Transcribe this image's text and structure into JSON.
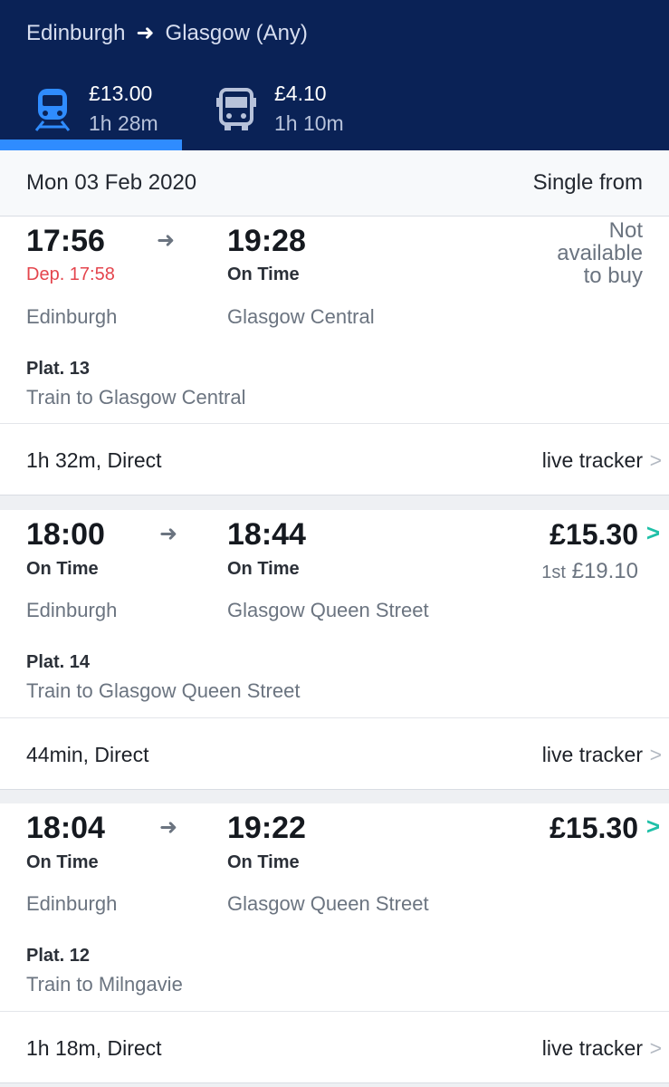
{
  "header": {
    "origin": "Edinburgh",
    "destination": "Glasgow (Any)",
    "modes": [
      {
        "icon": "train-icon",
        "price": "£13.00",
        "duration": "1h 28m"
      },
      {
        "icon": "bus-icon",
        "price": "£4.10",
        "duration": "1h 10m"
      }
    ]
  },
  "datebar": {
    "date": "Mon 03 Feb 2020",
    "fare_type": "Single from"
  },
  "journeys": [
    {
      "depart": "17:56",
      "depart_status": "Dep. 17:58",
      "arrive": "19:28",
      "arrive_status": "On Time",
      "from": "Edinburgh",
      "to": "Glasgow Central",
      "platform": "Plat. 13",
      "service": "Train to Glasgow Central",
      "availability": [
        "Not",
        "available",
        "to buy"
      ],
      "summary": "1h 32m, Direct",
      "tracker": "live tracker"
    },
    {
      "depart": "18:00",
      "depart_status": "On Time",
      "arrive": "18:44",
      "arrive_status": "On Time",
      "from": "Edinburgh",
      "to": "Glasgow Queen Street",
      "platform": "Plat. 14",
      "service": "Train to Glasgow Queen Street",
      "price": "£15.30",
      "first_label": "1st",
      "first_price": "£19.10",
      "summary": "44min, Direct",
      "tracker": "live tracker"
    },
    {
      "depart": "18:04",
      "depart_status": "On Time",
      "arrive": "19:22",
      "arrive_status": "On Time",
      "from": "Edinburgh",
      "to": "Glasgow Queen Street",
      "platform": "Plat. 12",
      "service": "Train to Milngavie",
      "price": "£15.30",
      "summary": "1h 18m, Direct",
      "tracker": "live tracker"
    }
  ],
  "colors": {
    "header_bg": "#0a2256",
    "accent": "#2f8cff",
    "late": "#e4454d",
    "price_chevron": "#1fc0a8"
  }
}
